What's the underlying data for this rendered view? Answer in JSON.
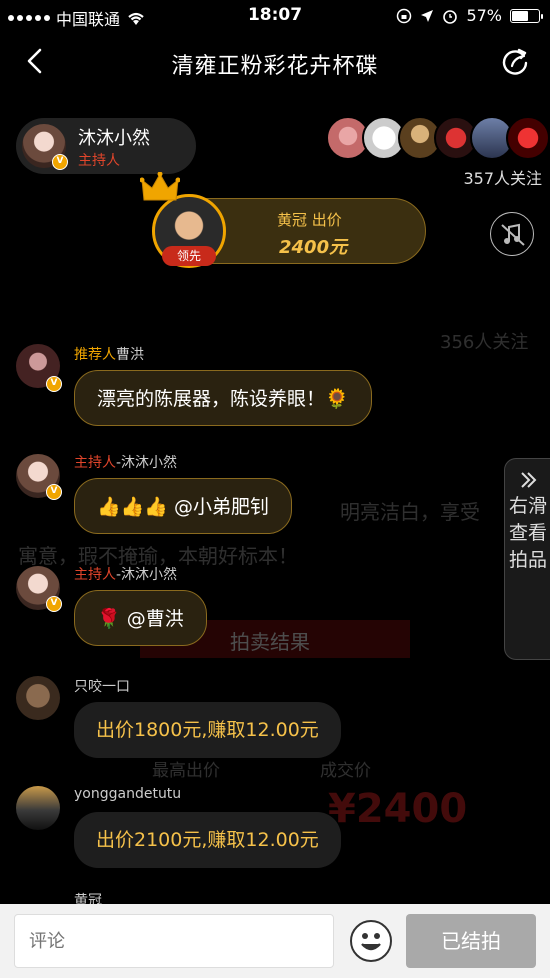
{
  "status_bar": {
    "carrier": "中国联通",
    "time": "18:07",
    "battery": "57%"
  },
  "nav": {
    "title": "清雍正粉彩花卉杯碟"
  },
  "host": {
    "name": "沐沐小然",
    "role": "主持人"
  },
  "followers": {
    "count_label": "357人关注"
  },
  "bid": {
    "label": "黄冠 出价",
    "amount": "2400元",
    "lead_tag": "领先"
  },
  "side_tab": {
    "label": "右滑查看拍品"
  },
  "background": {
    "follow_count": "356人关注",
    "quote_1": "明亮洁白，享受",
    "quote_2": "寓意，瑕不掩瑜，本朝好标本！",
    "banner": "拍卖结果",
    "highest_label": "最高出价",
    "deal_label": "成交价",
    "deal_price": "¥2400"
  },
  "messages": [
    {
      "role": "推荐人",
      "name": "曹洪",
      "text": "漂亮的陈展器，陈设养眼！🌻"
    },
    {
      "role": "主持人",
      "name": "-沐沐小然",
      "text": "👍👍👍 @小弟肥钊"
    },
    {
      "role": "主持人",
      "name": "-沐沐小然",
      "text": "🌹 @曹洪"
    },
    {
      "role": "",
      "name": "只咬一口",
      "text": "出价1800元,赚取12.00元"
    },
    {
      "role": "",
      "name": "yonggandetutu",
      "text": "出价2100元,赚取12.00元"
    },
    {
      "role": "",
      "name": "黄冠",
      "text": ""
    }
  ],
  "bottom": {
    "comment_placeholder": "评论",
    "end_button": "已结拍"
  },
  "colors": {
    "accent_gold": "#f5c14a",
    "host_red": "#e0452b"
  }
}
